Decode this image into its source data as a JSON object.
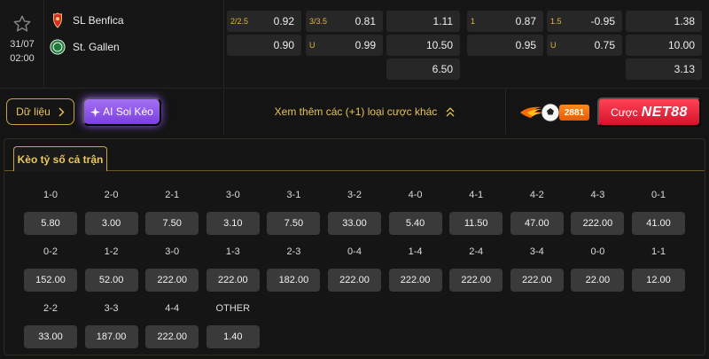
{
  "match": {
    "date": "31/07",
    "time": "02:00",
    "home_team": "SL Benfica",
    "away_team": "St. Gallen",
    "odds": {
      "handicap_ft": {
        "line": "2/2.5",
        "home": "0.92",
        "away": "0.90"
      },
      "ou_ft": {
        "line": "3/3.5",
        "over": "0.81",
        "under_tag": "U",
        "under": "0.99"
      },
      "x12_ft": {
        "home": "1.11",
        "away": "10.50",
        "draw": "6.50"
      },
      "handicap_h1": {
        "line": "1",
        "home": "0.87",
        "away": "0.95"
      },
      "ou_h1": {
        "line": "1.5",
        "over": "-0.95",
        "under_tag": "U",
        "under": "0.75"
      },
      "x12_h1": {
        "home": "1.38",
        "away": "10.00",
        "draw": "3.13"
      }
    }
  },
  "actions": {
    "data_label": "Dữ liệu",
    "ai_label": "AI Soi Kèo",
    "more_bets_label": "Xem thêm các (+1) loại cược khác",
    "promo_code": "2881",
    "net88_prefix": "Cược",
    "net88_brand": "NET88"
  },
  "colors": {
    "accent_gold": "#e6c458",
    "ai_purple": "#8b56f0",
    "net88_red": "#e5162e",
    "promo_orange": "#ff7a10"
  },
  "correct_score": {
    "tab_label": "Kèo tỷ số cả trận",
    "rows": [
      [
        {
          "score": "1-0",
          "odd": "5.80"
        },
        {
          "score": "2-0",
          "odd": "3.00"
        },
        {
          "score": "2-1",
          "odd": "7.50"
        },
        {
          "score": "3-0",
          "odd": "3.10"
        },
        {
          "score": "3-1",
          "odd": "7.50"
        },
        {
          "score": "3-2",
          "odd": "33.00"
        },
        {
          "score": "4-0",
          "odd": "5.40"
        },
        {
          "score": "4-1",
          "odd": "11.50"
        },
        {
          "score": "4-2",
          "odd": "47.00"
        },
        {
          "score": "4-3",
          "odd": "222.00"
        },
        {
          "score": "0-1",
          "odd": "41.00"
        }
      ],
      [
        {
          "score": "0-2",
          "odd": "152.00"
        },
        {
          "score": "1-2",
          "odd": "52.00"
        },
        {
          "score": "3-0",
          "odd": "222.00"
        },
        {
          "score": "1-3",
          "odd": "222.00"
        },
        {
          "score": "2-3",
          "odd": "182.00"
        },
        {
          "score": "0-4",
          "odd": "222.00"
        },
        {
          "score": "1-4",
          "odd": "222.00"
        },
        {
          "score": "2-4",
          "odd": "222.00"
        },
        {
          "score": "3-4",
          "odd": "222.00"
        },
        {
          "score": "0-0",
          "odd": "22.00"
        },
        {
          "score": "1-1",
          "odd": "12.00"
        }
      ],
      [
        {
          "score": "2-2",
          "odd": "33.00"
        },
        {
          "score": "3-3",
          "odd": "187.00"
        },
        {
          "score": "4-4",
          "odd": "222.00"
        },
        {
          "score": "OTHER",
          "odd": "1.40"
        }
      ]
    ]
  }
}
